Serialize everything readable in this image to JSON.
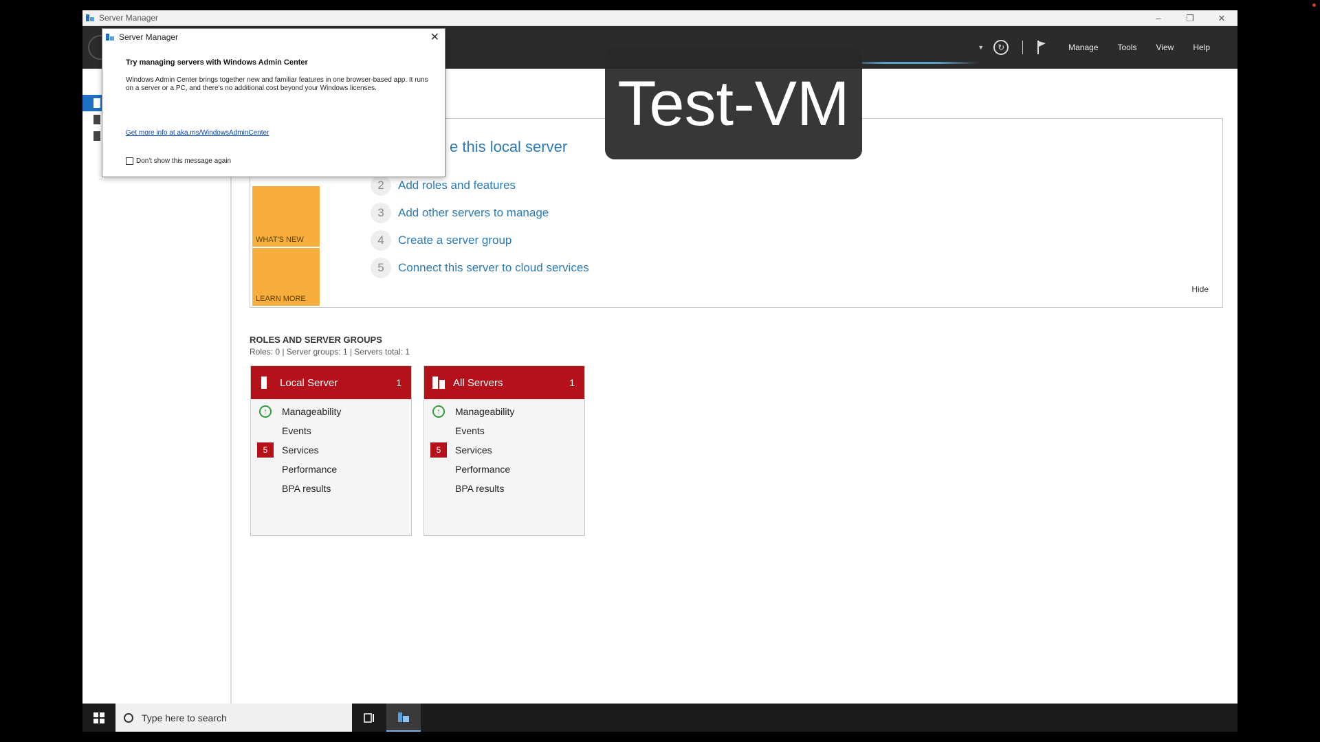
{
  "window": {
    "title": "Server Manager",
    "minimize": "–",
    "restore": "❐",
    "close": "✕"
  },
  "header": {
    "menu": [
      "Manage",
      "Tools",
      "View",
      "Help"
    ]
  },
  "welcome": {
    "title_partial": "e this local server",
    "steps": [
      {
        "num": "2",
        "label": "Add roles and features"
      },
      {
        "num": "3",
        "label": "Add other servers to manage"
      },
      {
        "num": "4",
        "label": "Create a server group"
      },
      {
        "num": "5",
        "label": "Connect this server to cloud services"
      }
    ],
    "side_labels": [
      "WHAT'S NEW",
      "LEARN MORE"
    ],
    "hide": "Hide"
  },
  "roles": {
    "heading": "ROLES AND SERVER GROUPS",
    "stats": "Roles: 0   |   Server groups: 1   |   Servers total: 1"
  },
  "tiles": [
    {
      "name": "Local Server",
      "count": "1",
      "rows": [
        "Manageability",
        "Events",
        "Services",
        "Performance",
        "BPA results"
      ],
      "services_badge": "5"
    },
    {
      "name": "All Servers",
      "count": "1",
      "rows": [
        "Manageability",
        "Events",
        "Services",
        "Performance",
        "BPA results"
      ],
      "services_badge": "5"
    }
  ],
  "dialog": {
    "title": "Server Manager",
    "heading": "Try managing servers with Windows Admin Center",
    "body": "Windows Admin Center brings together new and familiar features in one browser-based app. It runs on a server or a PC, and there's no additional cost beyond your Windows licenses.",
    "link": "Get more info at aka.ms/WindowsAdminCenter",
    "checkbox": "Don't show this message again",
    "close": "✕"
  },
  "overlay": {
    "text": "Test-VM"
  },
  "taskbar": {
    "search_placeholder": "Type here to search"
  },
  "colors": {
    "accent_red": "#b4111b",
    "orange": "#f7ae3c",
    "link_blue": "#2a7ab7",
    "header_dark": "#2b2b2b"
  }
}
